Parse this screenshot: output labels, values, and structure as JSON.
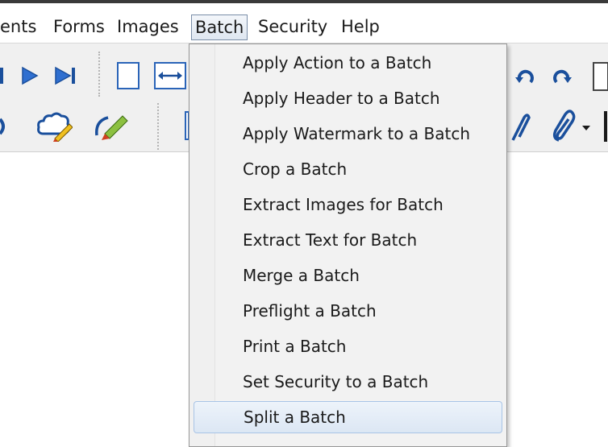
{
  "menubar": {
    "items": [
      "ents",
      "Forms",
      "Images",
      "Batch",
      "Security",
      "Help"
    ]
  },
  "toolbar": {
    "icons": [
      "play-icon",
      "last-page-icon",
      "fit-page-icon",
      "fit-width-icon",
      "rotate-counterclockwise-icon",
      "rotate-clockwise-icon",
      "page-icon",
      "cloud-comment-icon",
      "pencil-icon",
      "attach-icon",
      "paperclip-icon",
      "dropdown-arrow-icon"
    ]
  },
  "batch_menu": {
    "items": [
      "Apply Action to a Batch",
      "Apply Header to a Batch",
      "Apply Watermark to a Batch",
      "Crop a Batch",
      "Extract Images for Batch",
      "Extract Text for Batch",
      "Merge a Batch",
      "Preflight a Batch",
      "Print a Batch",
      "Set Security to a Batch",
      "Split a Batch"
    ],
    "highlighted": "Split a Batch"
  },
  "colors": {
    "menu_background": "#f2f2f2",
    "highlight": "#dce7f4",
    "icon_blue": "#1a4f9c"
  }
}
